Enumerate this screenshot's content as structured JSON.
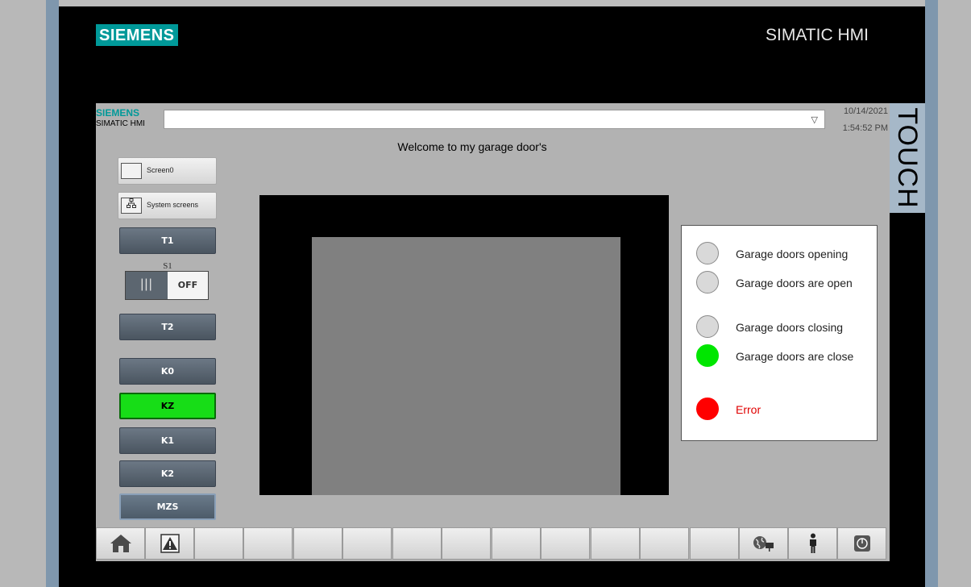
{
  "device": {
    "brand": "SIEMENS",
    "model": "SIMATIC HMI",
    "side_label": "TOUCH"
  },
  "header": {
    "brand": "SIEMENS",
    "model": "SIMATIC HMI",
    "screen_select_value": "",
    "date": "10/14/2021",
    "time": "1:54:52 PM"
  },
  "main": {
    "title": "Welcome to my garage door's"
  },
  "nav": {
    "screen0": "Screen0",
    "system_screens": "System screens"
  },
  "controls": {
    "t1": "T1",
    "s1_label": "S1",
    "s1_state": "OFF",
    "t2": "T2",
    "k0": "K0",
    "kz": "KZ",
    "k1": "K1",
    "k2": "K2",
    "mzs": "MZS"
  },
  "legend": [
    {
      "label": "Garage doors opening",
      "color": "#d9d9d9",
      "text_color": "#222222"
    },
    {
      "label": "Garage doors are open",
      "color": "#d9d9d9",
      "text_color": "#222222"
    },
    {
      "label": "Garage doors closing",
      "color": "#d9d9d9",
      "text_color": "#222222"
    },
    {
      "label": "Garage doors are close",
      "color": "#00e600",
      "text_color": "#222222"
    },
    {
      "label": "Error",
      "color": "#ff0000",
      "text_color": "#e00000"
    }
  ],
  "colors": {
    "siemens_teal": "#009999",
    "kz_active": "#17dd17",
    "lamp_off": "#d9d9d9",
    "lamp_on": "#00e600",
    "lamp_error": "#ff0000"
  },
  "taskbar": {
    "icons": [
      "home-icon",
      "alarm-warning-icon",
      "",
      "",
      "",
      "",
      "",
      "",
      "",
      "",
      "",
      "",
      "",
      "language-globe-icon",
      "user-icon",
      "power-icon"
    ]
  }
}
